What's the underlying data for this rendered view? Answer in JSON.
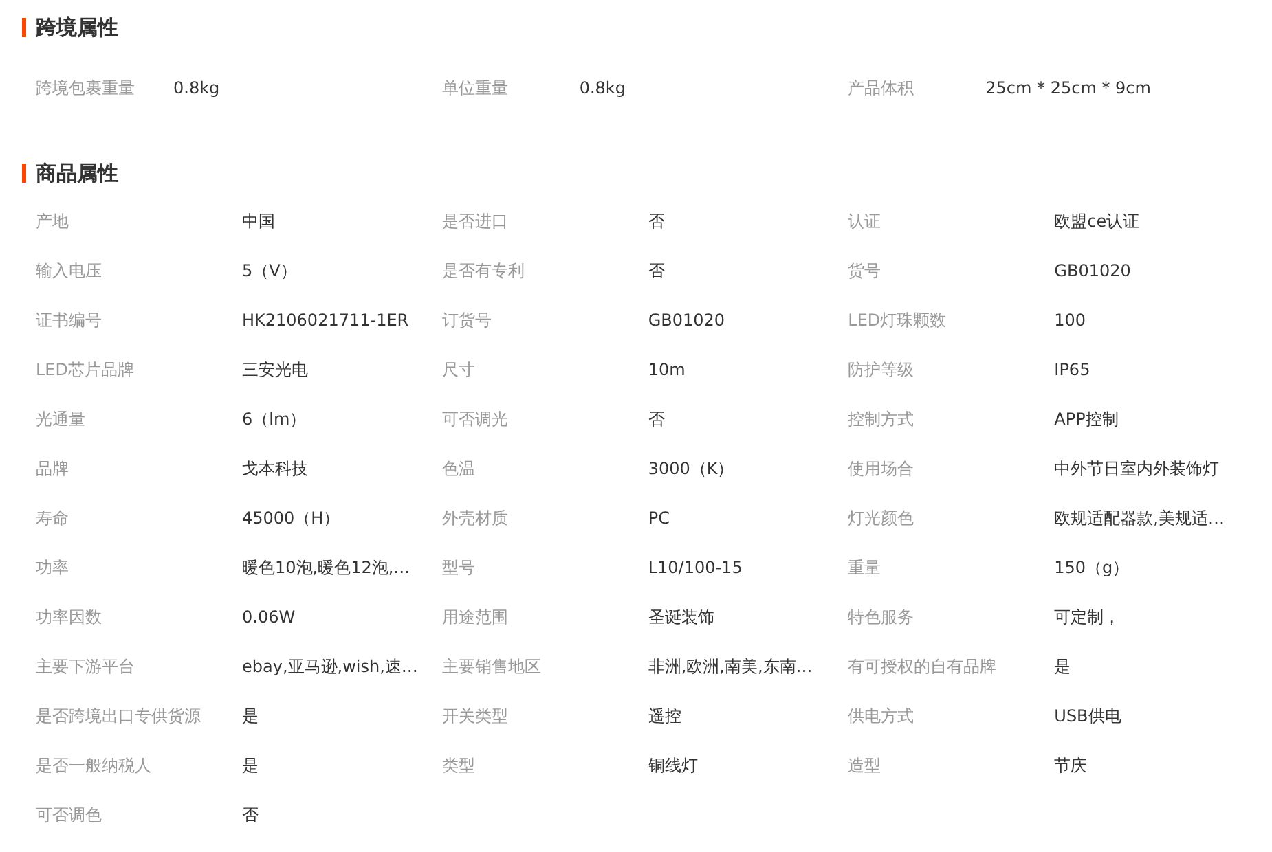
{
  "sections": [
    {
      "title": "跨境属性",
      "kind": "compact",
      "items": [
        {
          "label": "跨境包裹重量",
          "value": "0.8kg"
        },
        {
          "label": "单位重量",
          "value": "0.8kg"
        },
        {
          "label": "产品体积",
          "value": "25cm * 25cm * 9cm"
        }
      ]
    },
    {
      "title": "商品属性",
      "kind": "grid",
      "items": [
        {
          "label": "产地",
          "value": "中国"
        },
        {
          "label": "是否进口",
          "value": "否"
        },
        {
          "label": "认证",
          "value": "欧盟ce认证"
        },
        {
          "label": "输入电压",
          "value": "5（V）"
        },
        {
          "label": "是否有专利",
          "value": "否"
        },
        {
          "label": "货号",
          "value": "GB01020"
        },
        {
          "label": "证书编号",
          "value": "HK2106021711-1ER"
        },
        {
          "label": "订货号",
          "value": "GB01020"
        },
        {
          "label": "LED灯珠颗数",
          "value": "100"
        },
        {
          "label": "LED芯片品牌",
          "value": "三安光电"
        },
        {
          "label": "尺寸",
          "value": "10m"
        },
        {
          "label": "防护等级",
          "value": "IP65"
        },
        {
          "label": "光通量",
          "value": "6（lm）"
        },
        {
          "label": "可否调光",
          "value": "否"
        },
        {
          "label": "控制方式",
          "value": "APP控制"
        },
        {
          "label": "品牌",
          "value": "戈本科技"
        },
        {
          "label": "色温",
          "value": "3000（K）"
        },
        {
          "label": "使用场合",
          "value": "中外节日室内外装饰灯"
        },
        {
          "label": "寿命",
          "value": "45000（H）"
        },
        {
          "label": "外壳材质",
          "value": "PC"
        },
        {
          "label": "灯光颜色",
          "value": "欧规适配器款,美规适…"
        },
        {
          "label": "功率",
          "value": "暖色10泡,暖色12泡,…"
        },
        {
          "label": "型号",
          "value": "L10/100-15"
        },
        {
          "label": "重量",
          "value": "150（g）"
        },
        {
          "label": "功率因数",
          "value": "0.06W"
        },
        {
          "label": "用途范围",
          "value": "圣诞装饰"
        },
        {
          "label": "特色服务",
          "value": "可定制，"
        },
        {
          "label": "主要下游平台",
          "value": "ebay,亚马逊,wish,速…"
        },
        {
          "label": "主要销售地区",
          "value": "非洲,欧洲,南美,东南…"
        },
        {
          "label": "有可授权的自有品牌",
          "value": "是"
        },
        {
          "label": "是否跨境出口专供货源",
          "value": "是"
        },
        {
          "label": "开关类型",
          "value": "遥控"
        },
        {
          "label": "供电方式",
          "value": "USB供电"
        },
        {
          "label": "是否一般纳税人",
          "value": "是"
        },
        {
          "label": "类型",
          "value": "铜线灯"
        },
        {
          "label": "造型",
          "value": "节庆"
        },
        {
          "label": "可否调色",
          "value": "否"
        }
      ]
    }
  ]
}
